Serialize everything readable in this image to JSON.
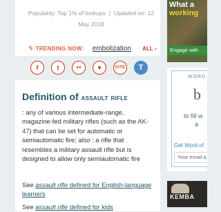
{
  "meta": {
    "popularity": "Popularity: Top 1% of lookups",
    "updated": "Updated on: 12 May 2018"
  },
  "trending": {
    "label": "TRENDING NOW:",
    "word": "embolization",
    "all_label": "ALL",
    "chevron": "›"
  },
  "share": {
    "facebook_icon": "f",
    "twitter_icon": "t",
    "community_icon": "●●",
    "favorite_icon": "♥",
    "cite_label": "CITE",
    "thesaurus_icon": "T"
  },
  "definition": {
    "heading_prefix": "Definition of",
    "heading_word": "assault rifle",
    "text_1": ": any of various intermediate-range, magazine-fed military rifles (such as the",
    "link_ak47": "AK-47",
    "text_2": ") that can be set for automatic or semiautomatic fire;",
    "also": "also",
    "text_3": ": a rifle that resembles a military assault rifle but is designed to allow only semiautomatic fire"
  },
  "see_also": [
    {
      "prefix": "See",
      "term": "assault rifle",
      "link_rest": "defined for English-language learners"
    },
    {
      "prefix": "See",
      "term": "assault rifle",
      "link_rest": "defined for kids"
    }
  ],
  "sidebar": {
    "ad_top": {
      "head_1": "What a",
      "head_2": "working",
      "button": "Engage with"
    },
    "wod": {
      "kicker": "WORD",
      "big_letter": "b",
      "fill_text": "to fill w",
      "fill_text_2": "a",
      "get_word": "Get Word of",
      "email_placeholder": "Your email a"
    },
    "ad_bottom": {
      "brand": "KEMBA",
      "sub": ""
    }
  },
  "colors": {
    "accent_red": "#d0391d",
    "link_teal": "#265667",
    "thesaurus_blue": "#4a8ac8",
    "background": "#e9eef0"
  }
}
